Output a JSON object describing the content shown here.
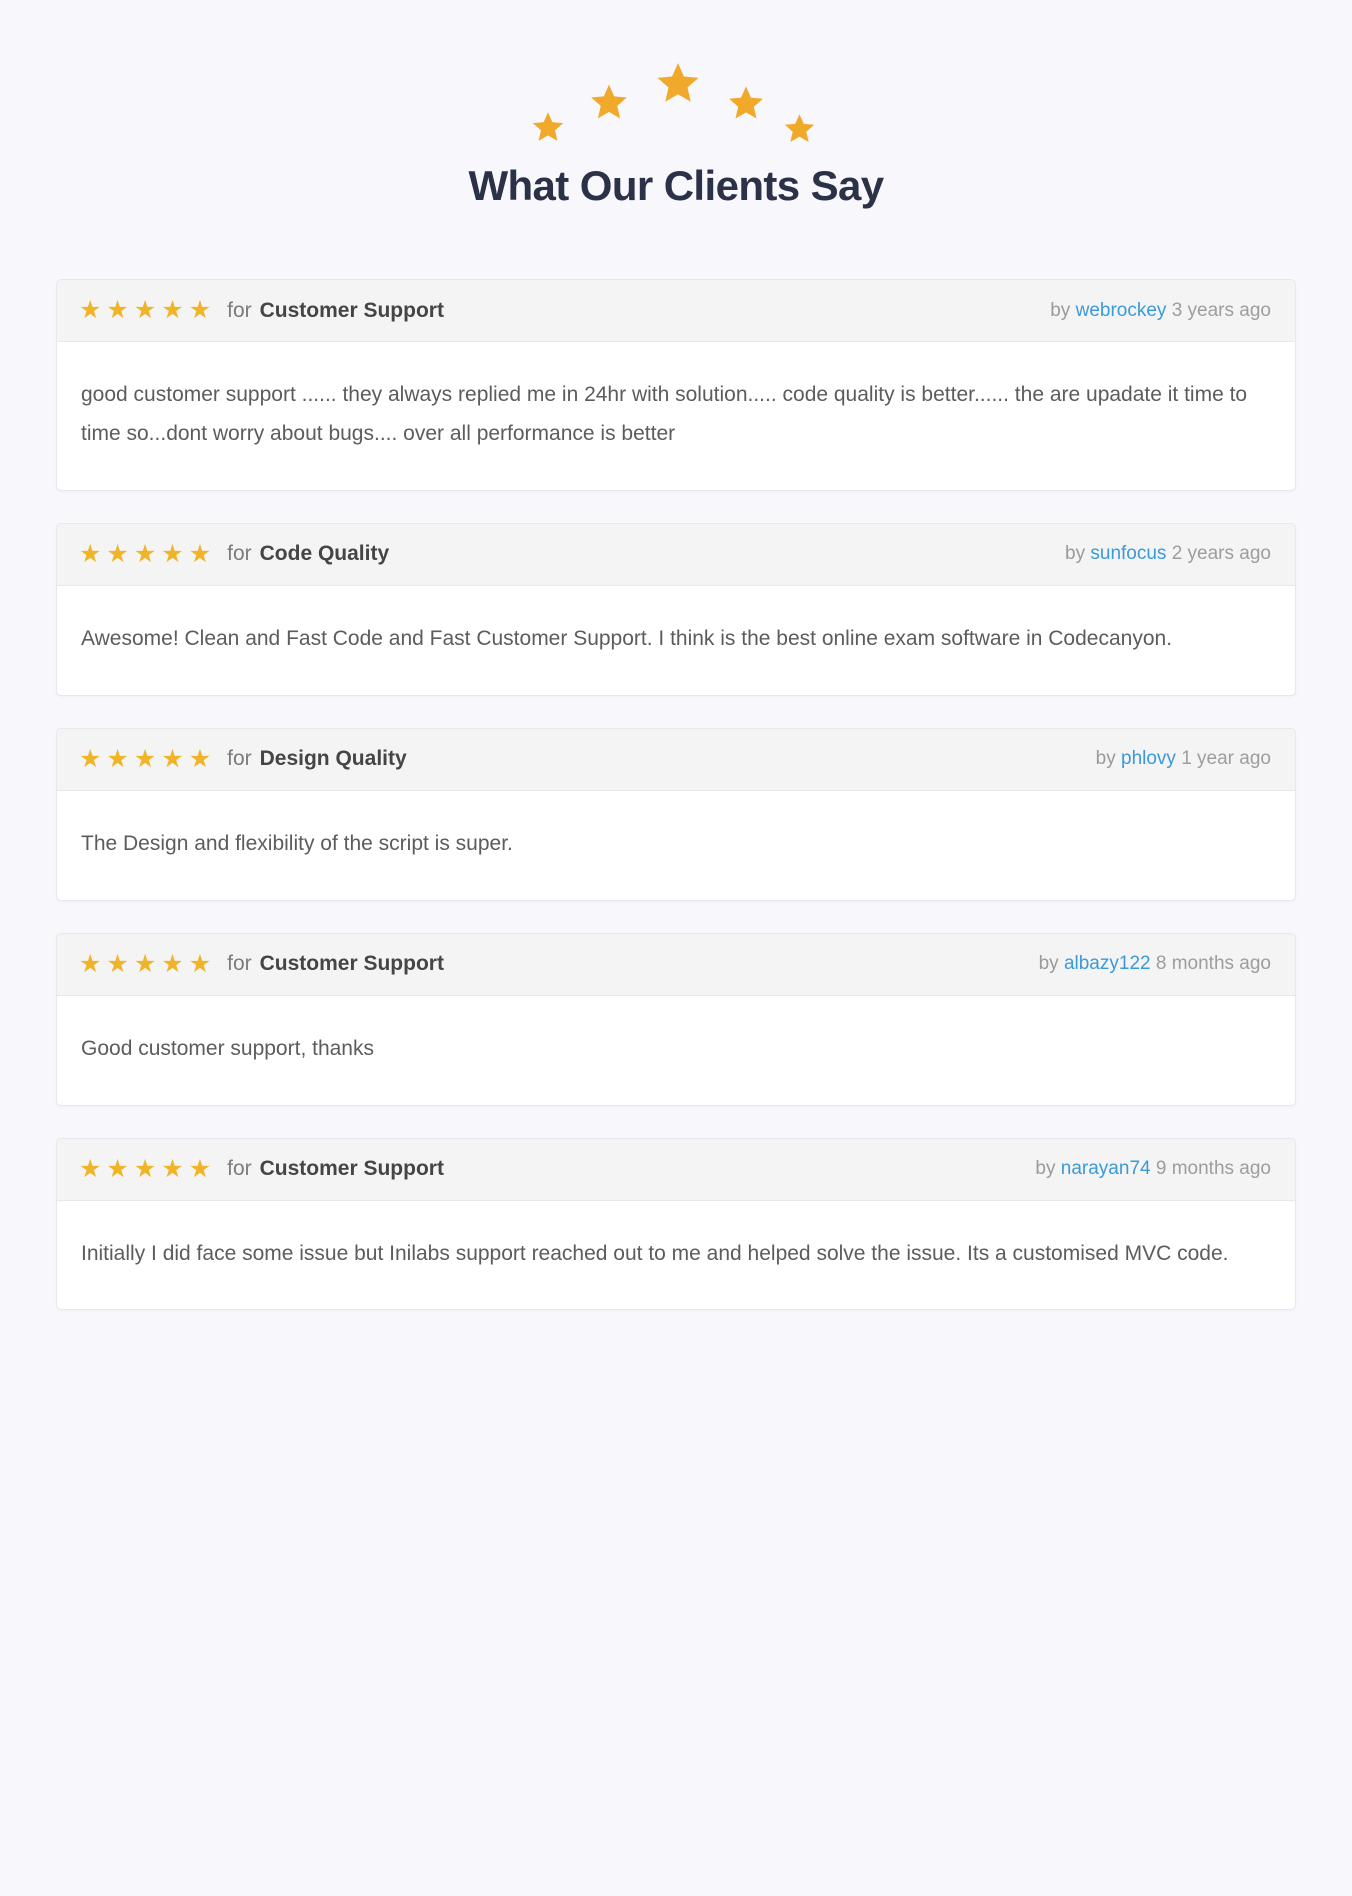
{
  "section": {
    "title": "What Our Clients Say",
    "decor_star_count": 5,
    "decor_star_color": "#f0a92a"
  },
  "colors": {
    "page_background": "#f7f7fc",
    "title": "#2b3147",
    "star_gold": "#f0b429",
    "card_background": "#ffffff",
    "card_header_background": "#f4f4f4",
    "card_border": "#e3e9ec",
    "body_text": "#5c5c5c",
    "muted_text": "#9a9a9a",
    "link": "#3a9ad9",
    "category_text": "#454545"
  },
  "labels": {
    "for": "for",
    "by": "by",
    "star_glyph": "★"
  },
  "reviews": [
    {
      "rating": 5,
      "category": "Customer Support",
      "author": "webrockey",
      "timeago": "3 years ago",
      "text": "good customer support ...... they always replied me in 24hr with solution..... code quality is better...... the are upadate it time to time so...dont worry about bugs.... over all performance is better"
    },
    {
      "rating": 5,
      "category": "Code Quality",
      "author": "sunfocus",
      "timeago": "2 years ago",
      "text": "Awesome! Clean and Fast Code and Fast Customer Support. I think is the best online exam software in Codecanyon."
    },
    {
      "rating": 5,
      "category": "Design Quality",
      "author": "phlovy",
      "timeago": "1 year ago",
      "text": "The Design and flexibility of the script is super."
    },
    {
      "rating": 5,
      "category": "Customer Support",
      "author": "albazy122",
      "timeago": "8 months ago",
      "text": "Good customer support, thanks"
    },
    {
      "rating": 5,
      "category": "Customer Support",
      "author": "narayan74",
      "timeago": "9 months ago",
      "text": "Initially I did face some issue but Inilabs support reached out to me and helped solve the issue. Its a customised MVC code."
    }
  ]
}
